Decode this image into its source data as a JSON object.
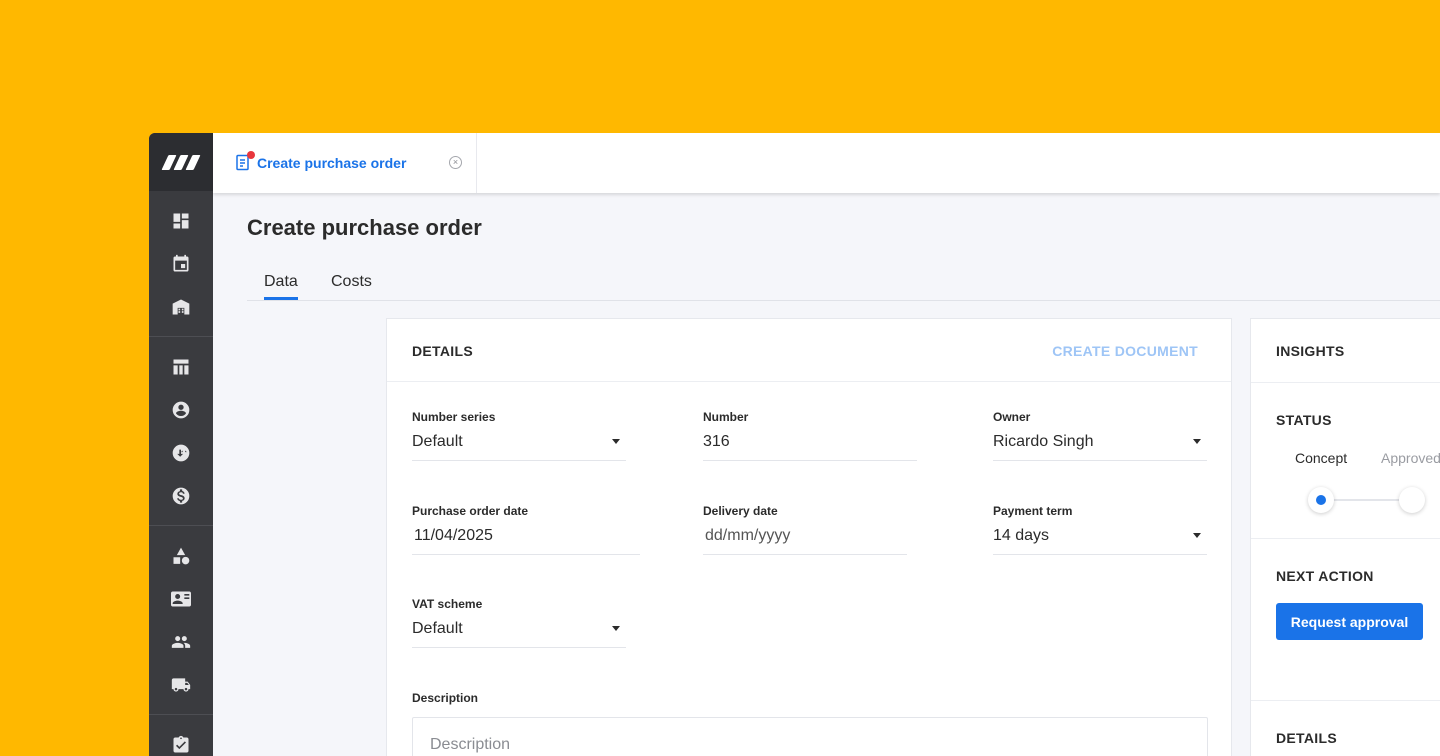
{
  "tabbar": {
    "active_tab_label": "Create purchase order",
    "close_symbol": "×"
  },
  "page": {
    "title": "Create purchase order",
    "tabs": [
      "Data",
      "Costs"
    ]
  },
  "details": {
    "title": "DETAILS",
    "create_document_label": "CREATE DOCUMENT",
    "fields": {
      "number_series": {
        "label": "Number series",
        "value": "Default"
      },
      "number": {
        "label": "Number",
        "value": "316"
      },
      "owner": {
        "label": "Owner",
        "value": "Ricardo Singh"
      },
      "purchase_order_date": {
        "label": "Purchase order date",
        "value": "11/04/2025"
      },
      "delivery_date": {
        "label": "Delivery date",
        "placeholder": "dd/mm/yyyy"
      },
      "payment_term": {
        "label": "Payment term",
        "value": "14 days"
      },
      "vat_scheme": {
        "label": "VAT scheme",
        "value": "Default"
      }
    },
    "description": {
      "label": "Description",
      "placeholder": "Description"
    }
  },
  "insights": {
    "title": "INSIGHTS",
    "status_title": "STATUS",
    "status_steps": [
      "Concept",
      "Approved"
    ],
    "next_action_title": "NEXT ACTION",
    "request_approval_label": "Request approval",
    "details_title": "DETAILS"
  },
  "colors": {
    "accent": "#1a73e8",
    "background": "#FFB800",
    "sidebar": "#3a3b3f"
  },
  "sidebar_icons": [
    "dashboard-icon",
    "calendar-icon",
    "warehouse-icon",
    "table-icon",
    "account-icon",
    "sync-icon",
    "dollar-icon",
    "shapes-icon",
    "contact-card-icon",
    "people-icon",
    "truck-icon",
    "clipboard-check-icon"
  ]
}
